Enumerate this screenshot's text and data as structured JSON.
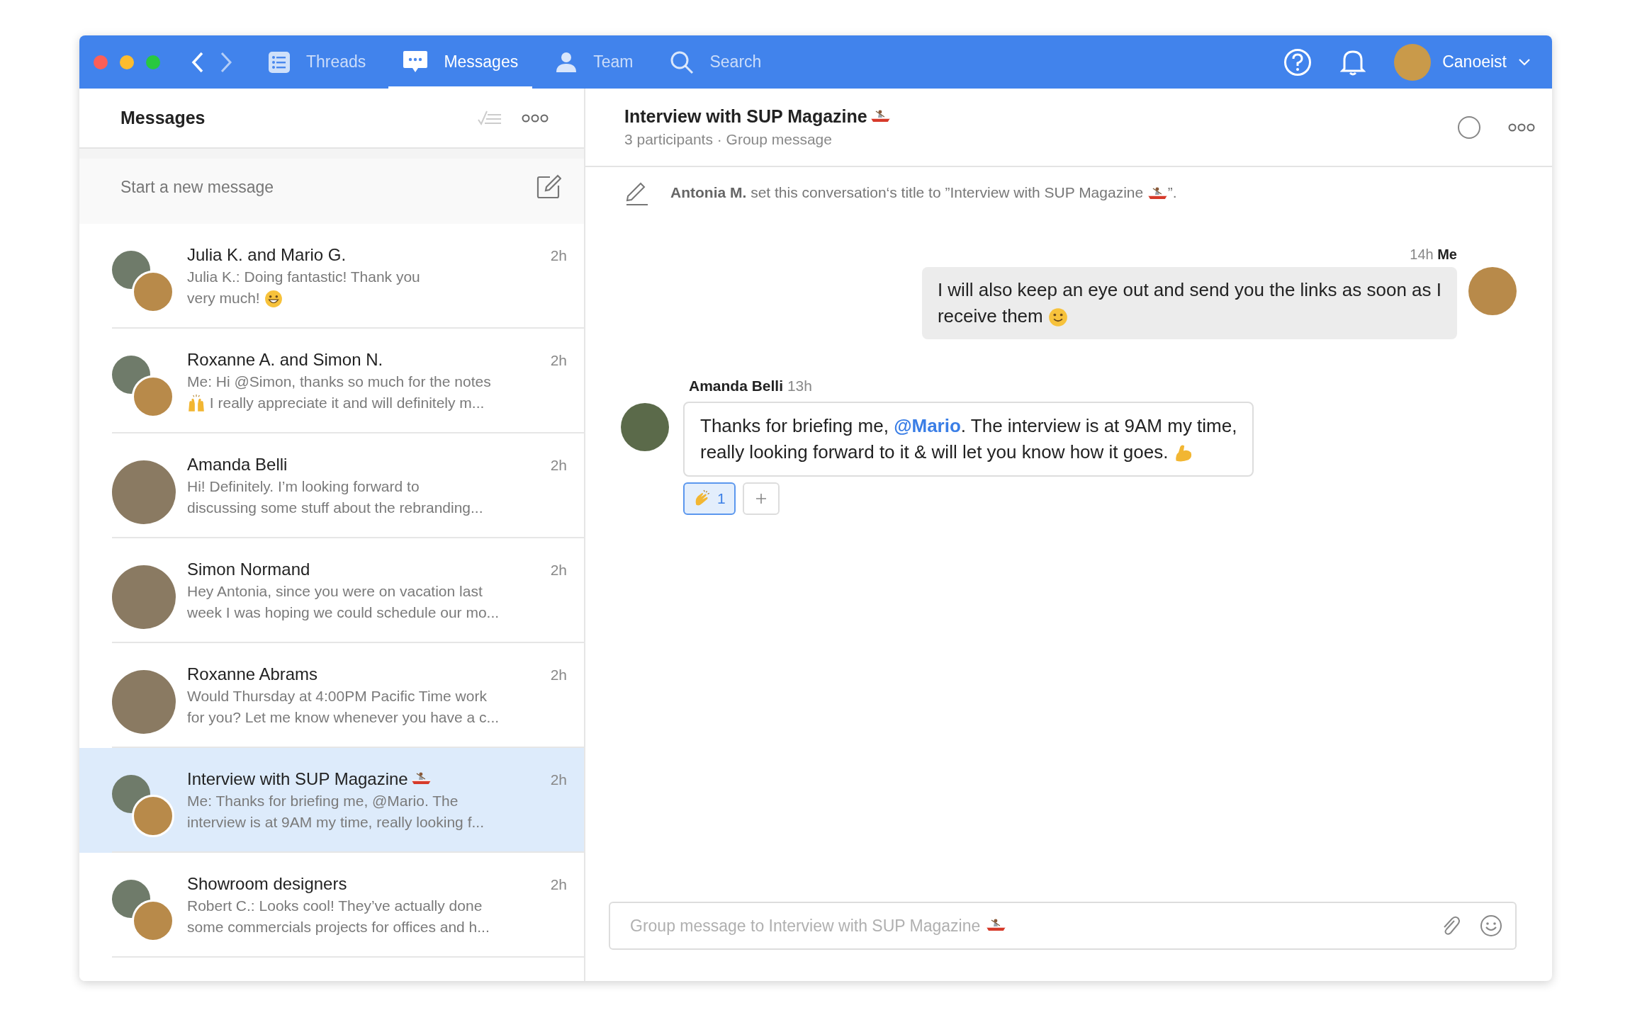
{
  "nav": {
    "tabs": [
      {
        "kind": "list",
        "label": "Threads",
        "selected": false
      },
      {
        "kind": "chat",
        "label": "Messages",
        "selected": true
      },
      {
        "kind": "person",
        "label": "Team",
        "selected": false
      },
      {
        "kind": "search",
        "label": "Search",
        "selected": false
      }
    ],
    "user": {
      "name": "Canoeist"
    }
  },
  "messages_panel": {
    "title": "Messages",
    "new_message": {
      "placeholder": "Start a new message"
    },
    "conversations": [
      {
        "kind": "pair",
        "selected": false,
        "time": "2h",
        "name": [
          {
            "kind": "text",
            "text": "Julia K. and Mario G."
          }
        ],
        "preview": [
          [
            {
              "kind": "text",
              "text": "Julia K.: Doing fantastic! Thank you"
            }
          ],
          [
            {
              "kind": "text",
              "text": "very much! "
            },
            {
              "kind": "grin"
            }
          ]
        ]
      },
      {
        "kind": "pair",
        "selected": false,
        "time": "2h",
        "name": [
          {
            "kind": "text",
            "text": "Roxanne A. and Simon N."
          }
        ],
        "preview": [
          [
            {
              "kind": "text",
              "text": "Me: Hi @Simon, thanks so much for the notes"
            }
          ],
          [
            {
              "kind": "hands"
            },
            {
              "kind": "text",
              "text": " I really appreciate it and will definitely m..."
            }
          ]
        ]
      },
      {
        "kind": "single",
        "selected": false,
        "time": "2h",
        "name": [
          {
            "kind": "text",
            "text": "Amanda Belli"
          }
        ],
        "preview": [
          [
            {
              "kind": "text",
              "text": "Hi! Definitely. I’m looking forward to"
            }
          ],
          [
            {
              "kind": "text",
              "text": "discussing some stuff about the rebranding..."
            }
          ]
        ]
      },
      {
        "kind": "single",
        "selected": false,
        "time": "2h",
        "name": [
          {
            "kind": "text",
            "text": "Simon Normand"
          }
        ],
        "preview": [
          [
            {
              "kind": "text",
              "text": "Hey Antonia, since you were on vacation last"
            }
          ],
          [
            {
              "kind": "text",
              "text": "week I was hoping we could schedule our mo..."
            }
          ]
        ]
      },
      {
        "kind": "single",
        "selected": false,
        "time": "2h",
        "name": [
          {
            "kind": "text",
            "text": "Roxanne Abrams"
          }
        ],
        "preview": [
          [
            {
              "kind": "text",
              "text": "Would Thursday at 4:00PM Pacific Time work"
            }
          ],
          [
            {
              "kind": "text",
              "text": "for you? Let me know whenever you have a c..."
            }
          ]
        ]
      },
      {
        "kind": "pair",
        "selected": true,
        "time": "2h",
        "name": [
          {
            "kind": "text",
            "text": "Interview with SUP Magazine "
          },
          {
            "kind": "boat"
          }
        ],
        "preview": [
          [
            {
              "kind": "text",
              "text": "Me: Thanks for briefing me, @Mario. The"
            }
          ],
          [
            {
              "kind": "text",
              "text": "interview is at 9AM my time, really looking f..."
            }
          ]
        ]
      },
      {
        "kind": "pair",
        "selected": false,
        "time": "2h",
        "name": [
          {
            "kind": "text",
            "text": "Showroom designers"
          }
        ],
        "preview": [
          [
            {
              "kind": "text",
              "text": "Robert C.: Looks cool! They’ve actually done"
            }
          ],
          [
            {
              "kind": "text",
              "text": "some commercials projects for offices and h..."
            }
          ]
        ]
      }
    ]
  },
  "conversation": {
    "title": [
      {
        "kind": "text",
        "text": "Interview with SUP Magazine "
      },
      {
        "kind": "boat"
      }
    ],
    "subtitle": "3 participants · Group message",
    "system_message": [
      {
        "kind": "bold",
        "text": "Antonia M."
      },
      {
        "kind": "text",
        "text": " set this conversation‘s title to ”Interview with SUP Magazine "
      },
      {
        "kind": "boat"
      },
      {
        "kind": "text",
        "text": "”."
      }
    ],
    "messages": [
      {
        "kind": "outgoing",
        "time": "14h",
        "sender": "Me",
        "lines": [
          [
            {
              "kind": "text",
              "text": "I will also keep an eye out and send you the links as soon as I"
            }
          ],
          [
            {
              "kind": "text",
              "text": "receive them "
            },
            {
              "kind": "smile"
            }
          ]
        ]
      },
      {
        "kind": "incoming",
        "time": "13h",
        "sender": "Amanda Belli",
        "lines": [
          [
            {
              "kind": "text",
              "text": "Thanks for briefing me, "
            },
            {
              "kind": "mention",
              "text": "@Mario"
            },
            {
              "kind": "text",
              "text": ". The interview is at 9AM my time,"
            }
          ],
          [
            {
              "kind": "text",
              "text": "really looking forward to it & will let you know how it goes. "
            },
            {
              "kind": "muscle"
            }
          ]
        ],
        "reactions": [
          {
            "kind": "clap",
            "count": "1",
            "selected": true
          }
        ]
      }
    ],
    "composer": {
      "placeholder": "Group message to Interview with SUP Magazine",
      "placeholder_end": [
        {
          "kind": "boat"
        }
      ]
    }
  }
}
